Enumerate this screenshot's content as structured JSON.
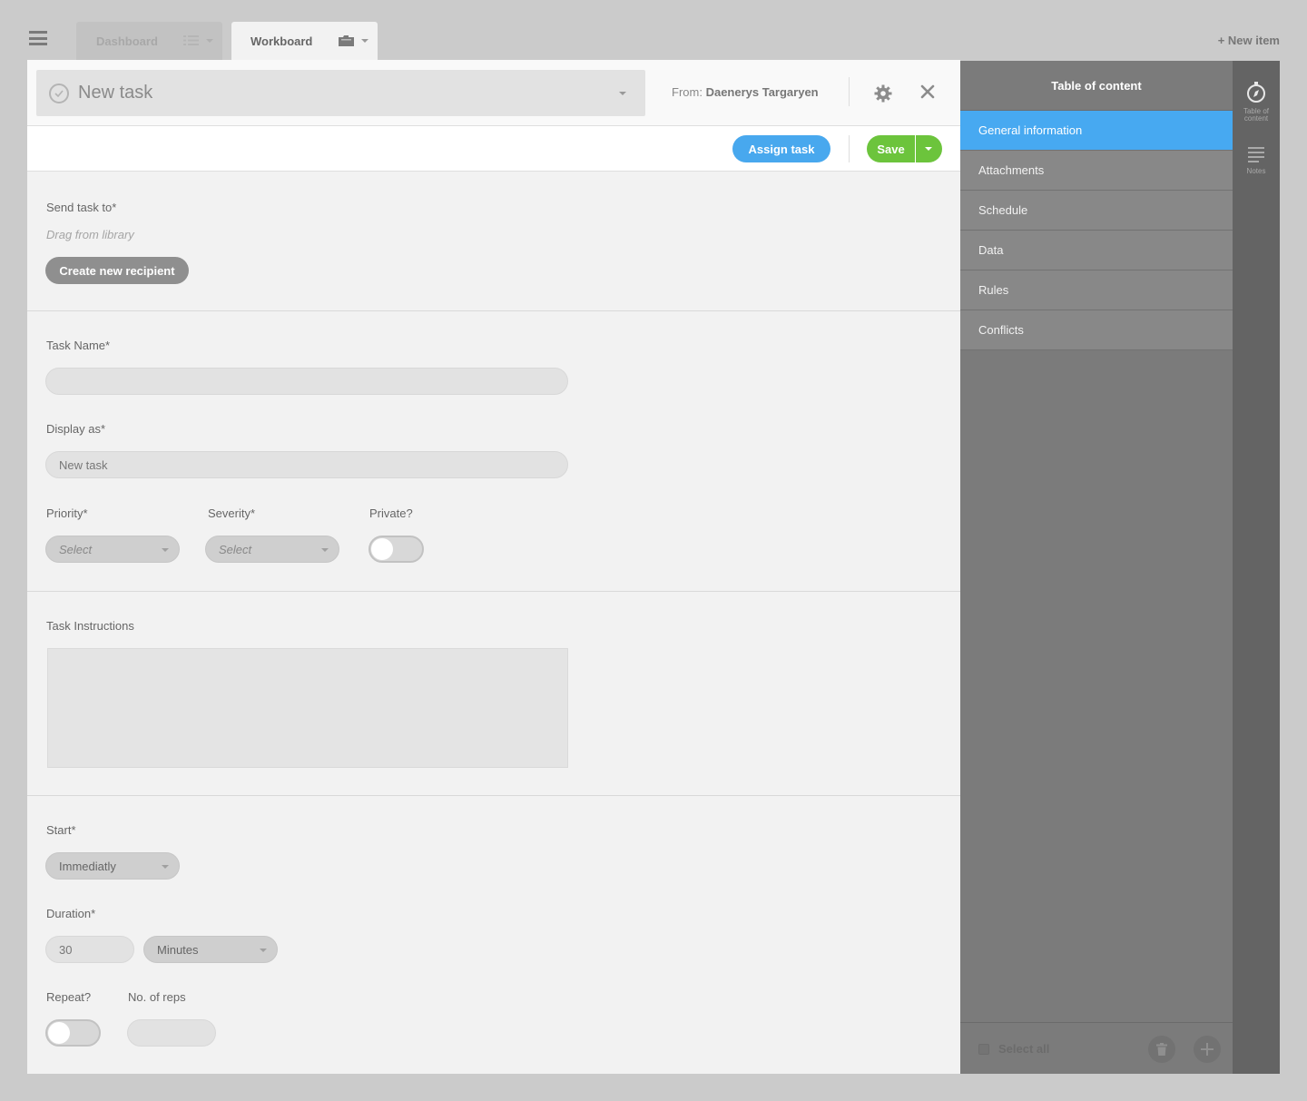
{
  "tabs": [
    {
      "label": "Dashboard",
      "icon": "grid-list-icon",
      "active": false
    },
    {
      "label": "Workboard",
      "icon": "folder-icon",
      "active": true
    }
  ],
  "header": {
    "new_item_label": "+ New item"
  },
  "task": {
    "title": "New task",
    "from_label": "From:",
    "from_name": "Daenerys Targaryen"
  },
  "actions": {
    "assign_label": "Assign task",
    "save_label": "Save"
  },
  "send": {
    "label": "Send task to*",
    "hint": "Drag from library",
    "create_label": "Create new recipient"
  },
  "details": {
    "task_name_label": "Task Name*",
    "task_name_value": "",
    "display_as_label": "Display as*",
    "display_as_value": "New task",
    "priority_label": "Priority*",
    "priority_value": "Select",
    "severity_label": "Severity*",
    "severity_value": "Select",
    "private_label": "Private?",
    "private_on": false
  },
  "instructions": {
    "label": "Task Instructions",
    "value": ""
  },
  "schedule": {
    "start_label": "Start*",
    "start_value": "Immediatly",
    "duration_label": "Duration*",
    "duration_value": "30",
    "duration_unit": "Minutes",
    "repeat_label": "Repeat?",
    "repeat_on": false,
    "reps_label": "No. of reps",
    "reps_value": ""
  },
  "toc": {
    "title": "Table of content",
    "items": [
      {
        "label": "General information",
        "active": true
      },
      {
        "label": "Attachments",
        "active": false
      },
      {
        "label": "Schedule",
        "active": false
      },
      {
        "label": "Data",
        "active": false
      },
      {
        "label": "Rules",
        "active": false
      },
      {
        "label": "Conflicts",
        "active": false
      }
    ],
    "select_all_label": "Select all"
  },
  "rail": {
    "items": [
      {
        "label_line1": "Table of",
        "label_line2": "content",
        "icon": "compass-icon"
      },
      {
        "label": "Notes",
        "icon": "notes-icon"
      }
    ]
  },
  "colors": {
    "accent_blue": "#47a9f1",
    "save_green": "#6cc43c",
    "toc_bg": "#7b7b7b",
    "rail_bg": "#646464"
  }
}
